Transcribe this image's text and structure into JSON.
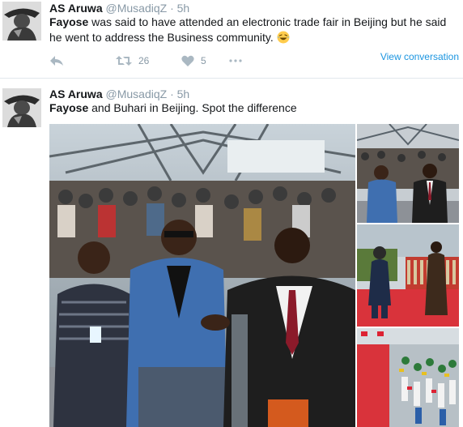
{
  "tweets": [
    {
      "author_name": "AS Aruwa",
      "handle": "@MusadiqZ",
      "separator": "·",
      "time": "5h",
      "text_bold": "Fayose",
      "text_rest": " was said to have attended an electronic trade fair in Beijing but he said he went to address the Business community. ",
      "emoji": "face-with-tears-of-joy",
      "actions": {
        "reply_icon": "reply-icon",
        "retweet_icon": "retweet-icon",
        "retweet_count": "26",
        "like_icon": "heart-icon",
        "like_count": "5"
      },
      "view_conversation": "View conversation"
    },
    {
      "author_name": "AS Aruwa",
      "handle": "@MusadiqZ",
      "separator": "·",
      "time": "5h",
      "text_bold": "Fayose",
      "text_rest": " and Buhari in Beijing. Spot the difference",
      "media": [
        {
          "name": "photo-fayose-trade-fair"
        },
        {
          "name": "photo-buhari-seated"
        },
        {
          "name": "photo-buhari-red-carpet"
        },
        {
          "name": "photo-welcome-ceremony"
        }
      ]
    }
  ],
  "colors": {
    "text": "#14171a",
    "muted": "#8899a6",
    "link": "#1b95e0",
    "divider": "#e1e8ed",
    "action_icon": "#aab8c2"
  }
}
